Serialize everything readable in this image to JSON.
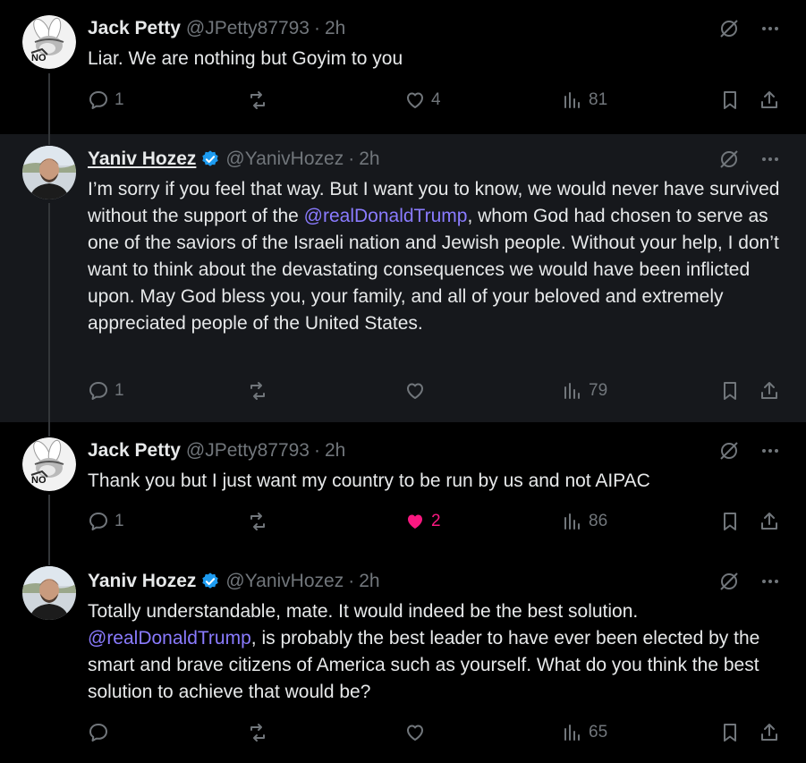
{
  "posts": [
    {
      "author": "Jack Petty",
      "handle": "@JPetty87793",
      "separator": "·",
      "time": "2h",
      "avatar_text": "NO",
      "text": "Liar. We are nothing but Goyim to you",
      "replies": "1",
      "reposts": "",
      "likes": "4",
      "views": "81"
    },
    {
      "author": "Yaniv Hozez",
      "handle": "@YanivHozez",
      "separator": "·",
      "time": "2h",
      "verified": true,
      "text_before": "I’m sorry if you feel that way. But I want you to know, we would never have survived without the support of the ",
      "mention": "@realDonaldTrump",
      "text_after": ", whom God had chosen to serve as one of the saviors of the Israeli nation and Jewish people. Without your help, I don’t want to think about the devastating consequences we would have been inflicted upon. May God bless you, your family, and all of your beloved and extremely appreciated people of the United States.",
      "replies": "1",
      "reposts": "",
      "likes": "",
      "views": "79"
    },
    {
      "author": "Jack Petty",
      "handle": "@JPetty87793",
      "separator": "·",
      "time": "2h",
      "avatar_text": "NO",
      "text": "Thank you but I just want my country to be run by us and not AIPAC",
      "replies": "1",
      "reposts": "",
      "likes": "2",
      "liked": true,
      "views": "86"
    },
    {
      "author": "Yaniv Hozez",
      "handle": "@YanivHozez",
      "separator": "·",
      "time": "2h",
      "verified": true,
      "text_before": "Totally understandable, mate. It would indeed be the best solution.",
      "mention": "@realDonaldTrump",
      "text_after": ", is probably the best leader to have ever been elected by the smart and brave citizens of America such as yourself. What do you think the best solution to achieve that would be?",
      "replies": "",
      "reposts": "",
      "likes": "",
      "views": "65"
    }
  ],
  "colors": {
    "background": "#000000",
    "highlight": "#16181c",
    "text": "#e7e9ea",
    "muted": "#71767b",
    "mention": "#8a7bff",
    "verified": "#1d9bf0",
    "like": "#f91880"
  },
  "icons": [
    "reply-icon",
    "repost-icon",
    "like-icon",
    "views-icon",
    "bookmark-icon",
    "share-icon",
    "grok-icon",
    "more-icon",
    "verified-badge-icon"
  ]
}
